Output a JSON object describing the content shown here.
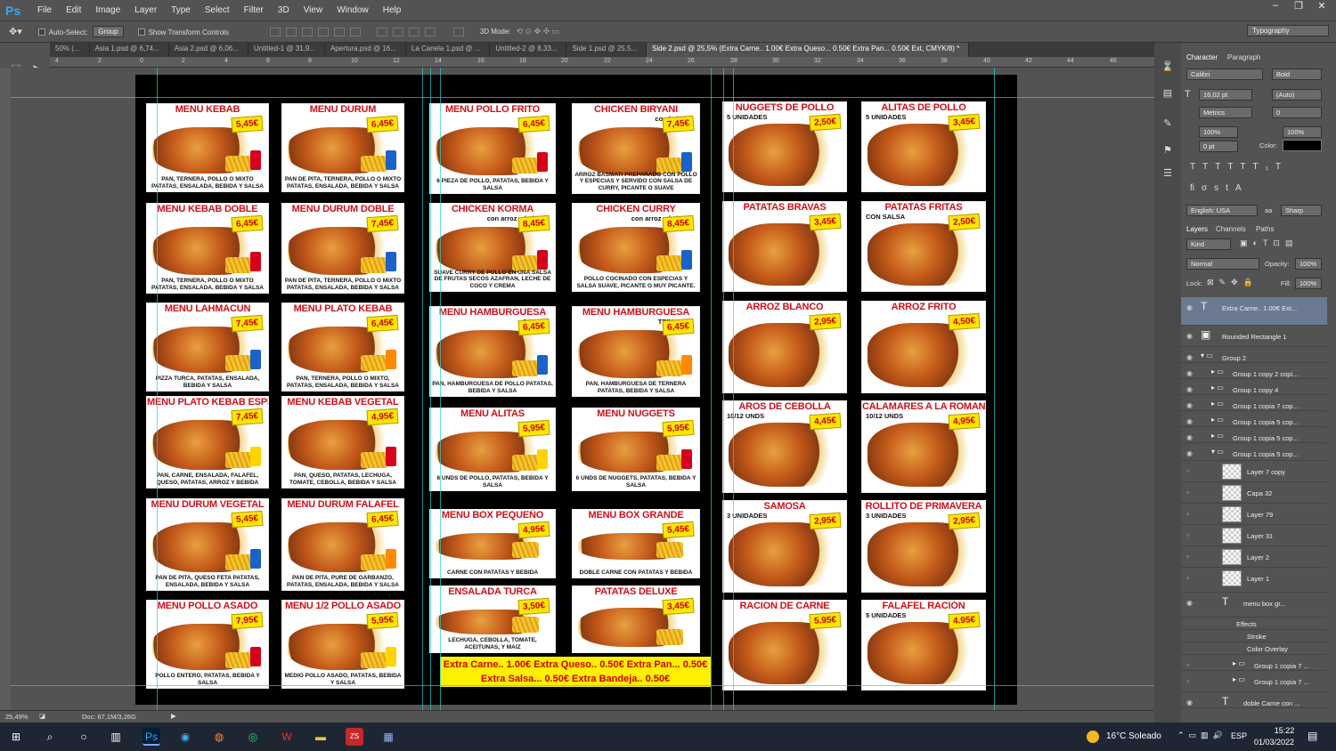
{
  "app": {
    "logo": "Ps",
    "menus": [
      "File",
      "Edit",
      "Image",
      "Layer",
      "Type",
      "Select",
      "Filter",
      "3D",
      "View",
      "Window",
      "Help"
    ],
    "workspace": "Typography"
  },
  "options": {
    "auto_select": "Auto-Select:",
    "group": "Group",
    "show_transform": "Show Transform Controls",
    "mode3d": "3D Mode:"
  },
  "tabs": [
    "50% (...",
    "Asia 1.psd @ 6,74...",
    "Asia 2.psd @ 6,06...",
    "Untitled-1 @ 31,9...",
    "Apertura.psd @ 16...",
    "La Canela 1.psd @ ...",
    "Untitled-2 @ 8,33...",
    "Side 1.psd @ 25,5...",
    "Side 2.psd @ 25,5% (Extra Carne.. 1.00€ Extra Queso... 0.50€ Extra Pan... 0.50€ Ext, CMYK/8) *"
  ],
  "ruler": [
    "4",
    "2",
    "0",
    "2",
    "4",
    "6",
    "8",
    "10",
    "12",
    "14",
    "16",
    "18",
    "20",
    "22",
    "24",
    "26",
    "28",
    "30",
    "32",
    "34",
    "36",
    "38",
    "40",
    "42",
    "44",
    "46"
  ],
  "status": {
    "zoom": "25,49%",
    "doc": "Doc: 67,1M/3,26G"
  },
  "cards": [
    {
      "title": "MENU KEBAB",
      "price": "5,45€",
      "desc": "PAN, TERNERA, POLLO O MIXTO PATATAS, ENSALADA, BEBIDA Y SALSA"
    },
    {
      "title": "MENU DURUM",
      "price": "6,45€",
      "desc": "PAN DE PITA, TERNERA, POLLO O MIXTO PATATAS, ENSALADA, BEBIDA Y SALSA"
    },
    {
      "title": "MENU KEBAB DOBLE",
      "price": "6,45€",
      "desc": "PAN, TERNERA, POLLO O MIXTO PATATAS, ENSALADA, BEBIDA Y SALSA"
    },
    {
      "title": "MENU DURUM DOBLE",
      "price": "7,45€",
      "desc": "PAN DE PITA, TERNERA, POLLO O MIXTO PATATAS, ENSALADA, BEBIDA Y SALSA"
    },
    {
      "title": "MENU LAHMACUN",
      "price": "7,45€",
      "desc": "PIZZA TURCA, PATATAS, ENSALADA, BEBIDA Y SALSA"
    },
    {
      "title": "MENU PLATO KEBAB",
      "price": "6,45€",
      "desc": "PAN, TERNERA, POLLO O MIXTO, PATATAS, ENSALADA, BEBIDA Y SALSA"
    },
    {
      "title": "MENU PLATO KEBAB ESPECIAL",
      "price": "7,45€",
      "desc": "PAN, CARNE, ENSALADA, FALAFEL, QUESO, PATATAS, ARROZ Y BEBIDA"
    },
    {
      "title": "MENU KEBAB VEGETAL",
      "price": "4,95€",
      "desc": "PAN, QUESO, PATATAS, LECHUGA, TOMATE, CEBOLLA, BEBIDA Y SALSA"
    },
    {
      "title": "MENU DURUM VEGETAL",
      "price": "5,45€",
      "desc": "PAN DE PITA, QUESO FETA PATATAS, ENSALADA, BEBIDA Y SALSA"
    },
    {
      "title": "MENU DURUM FALAFEL",
      "price": "6,45€",
      "desc": "PAN DE PITA, PURE DE GARBANZO, PATATAS, ENSALADA, BEBIDA Y SALSA"
    },
    {
      "title": "MENU POLLO ASADO",
      "price": "7,95€",
      "desc": "POLLO ENTERO, PATATAS, BEBIDA Y SALSA"
    },
    {
      "title": "MENU 1/2 POLLO ASADO",
      "price": "5,95€",
      "desc": "MEDIO POLLO ASADO, PATATAS, BEBIDA Y SALSA"
    },
    {
      "title": "MENU POLLO FRITO",
      "price": "6,45€",
      "desc": "6 PIEZA DE POLLO, PATATAS, BEBIDA Y SALSA"
    },
    {
      "title": "CHICKEN BIRYANI",
      "sub": "con bebida",
      "price": "7,45€",
      "desc": "ARROZ BASMATI PREPARADO CON POLLO Y ESPECIAS Y SERVIDO CON SALSA DE CURRY, PICANTE O SUAVE"
    },
    {
      "title": "CHICKEN KORMA",
      "sub": "con arroz y bebida",
      "price": "8,45€",
      "desc": "SUAVE CURRY DE POLLO EN UNA SALSA DE FRUTAS SECOS AZAFRAN, LECHE DE COCO Y CREMA"
    },
    {
      "title": "CHICKEN CURRY",
      "sub": "con arroz y bebida",
      "price": "8,45€",
      "desc": "POLLO COCINADO CON ESPECIAS Y SALSA SUAVE, PICANTE O MUY PICANTE."
    },
    {
      "title": "MENU HAMBURGUESA",
      "sub": "POLLO",
      "price": "6,45€",
      "desc": "PAN, HAMBURGUESA DE POLLO PATATAS, BEBIDA Y SALSA"
    },
    {
      "title": "MENU HAMBURGUESA",
      "sub": "TERNERA",
      "price": "6,45€",
      "desc": "PAN, HAMBURGUESA DE TERNERA PATATAS, BEBIDA Y SALSA"
    },
    {
      "title": "MENU ALITAS",
      "price": "5,95€",
      "desc": "6 UNDS DE POLLO, PATATAS, BEBIDA Y SALSA"
    },
    {
      "title": "MENU NUGGETS",
      "price": "5,95€",
      "desc": "6 UNDS DE NUGGETS, PATATAS, BEBIDA Y SALSA"
    },
    {
      "title": "MENU BOX PEQUEÑO",
      "price": "4,95€",
      "desc": "CARNE CON PATATAS Y BEBIDA"
    },
    {
      "title": "MENU BOX GRANDE",
      "price": "5,45€",
      "desc": "DOBLE CARNE CON PATATAS Y BEBIDA"
    },
    {
      "title": "ENSALADA TURCA",
      "price": "3,50€",
      "desc": "LECHUGA, CEBOLLA, TOMATE, ACEITUNAS, Y MAIZ"
    },
    {
      "title": "PATATAS DELUXE",
      "price": "3,45€",
      "desc": ""
    },
    {
      "title": "NUGGETS DE POLLO",
      "sub": "5 UNIDADES",
      "price": "2,50€",
      "desc": ""
    },
    {
      "title": "ALITAS DE POLLO",
      "sub": "5 UNIDADES",
      "price": "3,45€",
      "desc": ""
    },
    {
      "title": "PATATAS BRAVAS",
      "price": "3,45€",
      "desc": ""
    },
    {
      "title": "PATATAS FRITAS",
      "sub": "CON SALSA",
      "price": "2,50€",
      "desc": ""
    },
    {
      "title": "ARROZ BLANCO",
      "price": "2,95€",
      "desc": ""
    },
    {
      "title": "ARROZ FRITO",
      "price": "4,50€",
      "desc": ""
    },
    {
      "title": "AROS DE CEBOLLA",
      "sub": "10/12 UNDS",
      "price": "4,45€",
      "desc": ""
    },
    {
      "title": "CALAMARES A LA ROMANA",
      "sub": "10/12 UNDS",
      "price": "4,95€",
      "desc": ""
    },
    {
      "title": "SAMOSA",
      "sub": "3 UNIDADES",
      "price": "2,95€",
      "desc": ""
    },
    {
      "title": "ROLLITO DE PRIMAVERA",
      "sub": "3 UNIDADES",
      "price": "2,95€",
      "desc": ""
    },
    {
      "title": "RACION DE CARNE",
      "price": "5.95€",
      "desc": ""
    },
    {
      "title": "FALAFEL RACIÓN",
      "sub": "5 UNIDADES",
      "price": "4.95€",
      "desc": ""
    }
  ],
  "extras": {
    "line1": "Extra Carne.. 1.00€ Extra Queso.. 0.50€  Extra Pan... 0.50€",
    "line2": "Extra Salsa... 0.50€  Extra Bandeja.. 0.50€"
  },
  "panel": {
    "tab_char": "Character",
    "tab_para": "Paragraph",
    "font": "Calibri",
    "style": "Bold",
    "size": "16,02 pt",
    "leading": "(Auto)",
    "kerning": "Metrics",
    "tracking": "0",
    "vscale": "100%",
    "hscale": "100%",
    "baseline": "0 pt",
    "color_label": "Color:",
    "lang": "English: USA",
    "aa_label": "aa",
    "aa": "Sharp",
    "layers_tab": "Layers",
    "channels_tab": "Channels",
    "paths_tab": "Paths",
    "kind": "Kind",
    "blend": "Normal",
    "opacity_label": "Opacity:",
    "opacity": "100%",
    "lock": "Lock:",
    "fill_label": "Fill:",
    "fill": "100%",
    "layers": [
      "Extra Carne.. 1.00€ Ext...",
      "Rounded Rectangle 1",
      "Group 2",
      "Group 1 copy 2 copi...",
      "Group 1 copy 4",
      "Group 1 copia 7 cop...",
      "Group 1 copia 5 cop...",
      "Group 1 copia 5 cop...",
      "Group 1 copia 5 cop...",
      "Layer 7 copy",
      "Capa 32",
      "Layer 79",
      "Layer 31",
      "Layer 2",
      "Layer 1",
      "menu box gr...",
      "Effects",
      "Stroke",
      "Color Overlay",
      "Group 1 copia 7 ...",
      "Group 1 copia 7 ...",
      "doble Carne con ..."
    ]
  },
  "taskbar": {
    "weather": "16°C  Soleado",
    "lang": "ESP",
    "time": "15:22",
    "date": "01/03/2022"
  }
}
